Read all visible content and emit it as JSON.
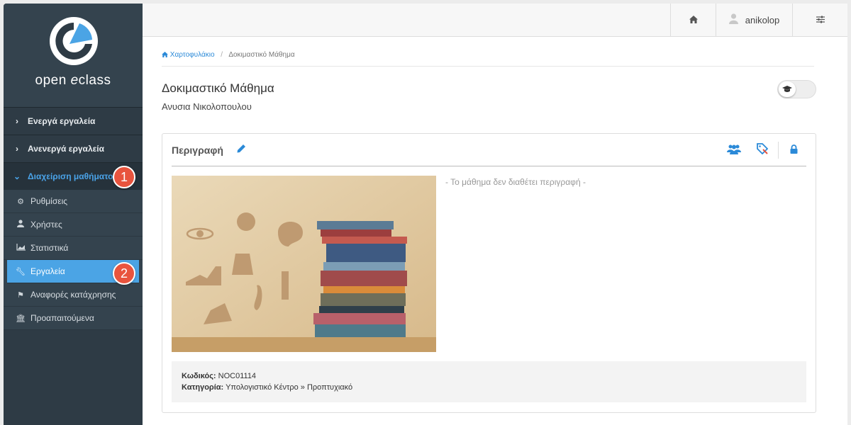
{
  "app": {
    "logo_text_open": "open ",
    "logo_text_e": "e",
    "logo_text_class": "class"
  },
  "sidebar": {
    "sections": [
      {
        "label": "Ενεργά εργαλεία",
        "chevron": "chevron-right-icon"
      },
      {
        "label": "Ανενεργά εργαλεία",
        "chevron": "chevron-right-icon"
      },
      {
        "label": "Διαχείριση μαθήματος",
        "chevron": "chevron-down-icon",
        "active": true
      }
    ],
    "items": [
      {
        "label": "Ρυθμίσεις",
        "icon": "cogs-icon"
      },
      {
        "label": "Χρήστες",
        "icon": "user-icon"
      },
      {
        "label": "Στατιστικά",
        "icon": "area-chart-icon"
      },
      {
        "label": "Εργαλεία",
        "icon": "wrench-icon",
        "active": true
      },
      {
        "label": "Αναφορές κατάχρησης",
        "icon": "flag-icon"
      },
      {
        "label": "Προαπαιτούμενα",
        "icon": "university-icon"
      }
    ],
    "annotations": [
      "1",
      "2"
    ]
  },
  "topbar": {
    "home_icon": "home-icon",
    "user_icon": "user-icon",
    "username": "anikolop",
    "settings_icon": "sliders-icon"
  },
  "breadcrumb": {
    "home": "Χαρτοφυλάκιο",
    "current": "Δοκιμαστικό Μάθημα"
  },
  "course": {
    "title": "Δοκιμαστικό Μάθημα",
    "professor": "Ανυσια Νικολοπουλου",
    "description_title": "Περιγραφή",
    "no_description": "- Το μάθημα δεν διαθέτει περιγραφή -",
    "code_label": "Κωδικός:",
    "code_value": " NOC01114",
    "category_label": "Κατηγορία:",
    "category_value": " Υπολογιστικό Κέντρο » Προπτυχιακό"
  },
  "colors": {
    "sidebar_bg": "#2e3b45",
    "accent": "#2b8ad8",
    "active_item": "#4ba4e5",
    "badge": "#e8543e"
  }
}
